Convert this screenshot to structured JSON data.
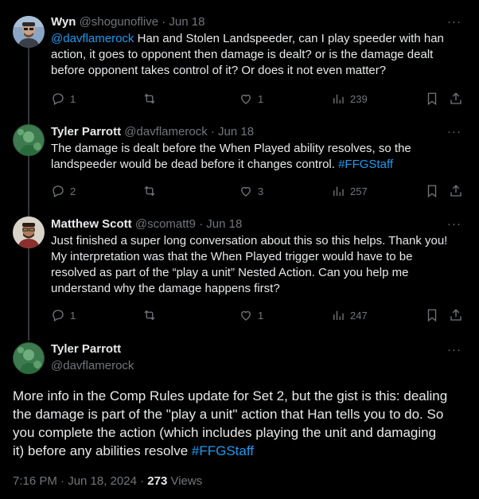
{
  "tweets": [
    {
      "name": "Wyn",
      "handle": "@shogunoflive",
      "sep": "·",
      "date": "Jun 18",
      "mention": "@davflamerock",
      "text_1": " Han and Stolen Landspeeder, can I play speeder with han",
      "text_2": "action, it goes to opponent then damage is dealt? or is the damage dealt",
      "text_3": "before opponent takes control of it? Or does it not even matter?",
      "replies": "1",
      "retweets": "",
      "likes": "1",
      "views": "239"
    },
    {
      "name": "Tyler Parrott",
      "handle": "@davflamerock",
      "sep": "·",
      "date": "Jun 18",
      "text_1": "The damage is dealt before the When Played ability resolves, so the",
      "text_2": "landspeeder would be dead before it changes control. ",
      "hashtag": "#FFGStaff",
      "replies": "2",
      "retweets": "",
      "likes": "3",
      "views": "257"
    },
    {
      "name": "Matthew Scott",
      "handle": "@scomatt9",
      "sep": "·",
      "date": "Jun 18",
      "text_1": "Just finished a super long conversation about this so this helps. Thank you!",
      "text_2": "My interpretation was that the When Played trigger would have to be",
      "text_3": "resolved as part of the “play a unit” Nested Action. Can you help me",
      "text_4": "understand why the damage happens first?",
      "replies": "1",
      "retweets": "",
      "likes": "1",
      "views": "247"
    }
  ],
  "main_tweet": {
    "name": "Tyler Parrott",
    "handle": "@davflamerock",
    "line_1": "More info in the Comp Rules update for Set 2, but the gist is this: dealing",
    "line_2": "the damage is part of the \"play a unit\" action that Han tells you to do. So",
    "line_3": "you complete the action (which includes playing the unit and damaging",
    "line_4": "it) before any abilities resolve ",
    "hashtag": "#FFGStaff",
    "time": "7:16 PM · Jun 18, 2024 · ",
    "views_count": "273",
    "views_label": " Views"
  },
  "icons": {
    "reply": "reply-icon",
    "retweet": "retweet-icon",
    "like": "heart-icon",
    "views": "views-icon",
    "bookmark": "bookmark-icon",
    "share": "share-icon",
    "more": "more-icon"
  },
  "colors": {
    "background": "#000000",
    "text": "#e7e9ea",
    "muted": "#71767b",
    "link": "#1d9bf0",
    "thread_line": "#333639"
  }
}
